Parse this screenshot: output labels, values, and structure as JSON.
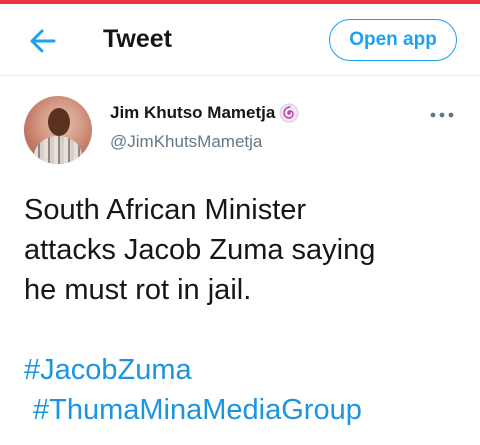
{
  "header": {
    "title": "Tweet",
    "open_app_label": "Open app",
    "back_icon": "arrow-left-icon"
  },
  "tweet": {
    "author": {
      "display_name": "Jim Khutso Mametja",
      "handle": "@JimKhutsMametja",
      "badge_icon": "spiral-badge-icon"
    },
    "text_lines": [
      "South African Minister",
      "attacks Jacob Zuma saying",
      "he must rot in jail."
    ],
    "hashtags": [
      "#JacobZuma",
      "#ThumaMinaMediaGroup"
    ]
  },
  "colors": {
    "accent": "#1da1f2",
    "hashtag": "#1b95e0",
    "top_bar": "#ea3340",
    "text": "#14171a",
    "muted": "#657786"
  }
}
